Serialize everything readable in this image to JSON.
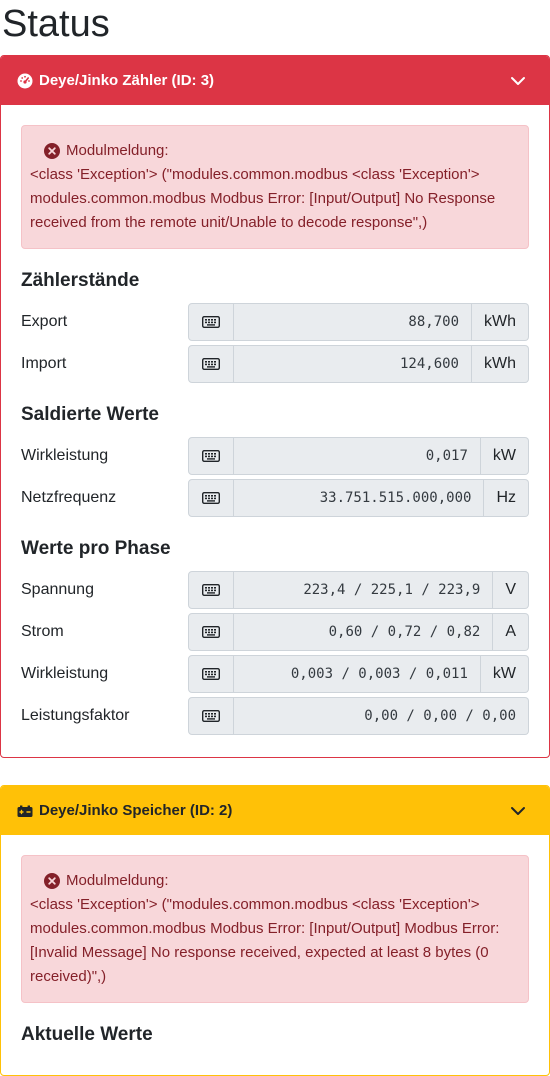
{
  "page": {
    "title": "Status"
  },
  "counter_card": {
    "title": "Deye/Jinko Zähler (ID: 3)",
    "alert": {
      "title": "Modulmeldung:",
      "text": "<class 'Exception'> (\"modules.common.modbus <class 'Exception'> modules.common.modbus Modbus Error: [Input/Output] No Response received from the remote unit/Unable to decode response\",)"
    },
    "sections": [
      {
        "title": "Zählerstände",
        "rows": [
          {
            "label": "Export",
            "value": "88,700",
            "unit": "kWh"
          },
          {
            "label": "Import",
            "value": "124,600",
            "unit": "kWh"
          }
        ]
      },
      {
        "title": "Saldierte Werte",
        "rows": [
          {
            "label": "Wirkleistung",
            "value": "0,017",
            "unit": "kW"
          },
          {
            "label": "Netzfrequenz",
            "value": "33.751.515.000,000",
            "unit": "Hz"
          }
        ]
      },
      {
        "title": "Werte pro Phase",
        "rows": [
          {
            "label": "Spannung",
            "value": "223,4 / 225,1 / 223,9",
            "unit": "V"
          },
          {
            "label": "Strom",
            "value": "0,60 / 0,72 / 0,82",
            "unit": "A"
          },
          {
            "label": "Wirkleistung",
            "value": "0,003 / 0,003 / 0,011",
            "unit": "kW"
          },
          {
            "label": "Leistungsfaktor",
            "value": "0,00 / 0,00 / 0,00",
            "unit": ""
          }
        ]
      }
    ]
  },
  "storage_card": {
    "title": "Deye/Jinko Speicher (ID: 2)",
    "alert": {
      "title": "Modulmeldung:",
      "text": "<class 'Exception'> (\"modules.common.modbus <class 'Exception'> modules.common.modbus Modbus Error: [Input/Output] Modbus Error: [Invalid Message] No response received, expected at least 8 bytes (0 received)\",)"
    },
    "section_title": "Aktuelle Werte"
  },
  "icons": {
    "counter_header": "gauge-icon",
    "storage_header": "battery-icon",
    "collapse": "chevron-down-icon",
    "error": "x-circle-icon",
    "field": "keyboard-icon"
  },
  "colors": {
    "danger": "#dc3545",
    "warning": "#ffc107",
    "alert_bg": "#f8d7da",
    "alert_text": "#842029",
    "input_bg": "#e9ecef"
  }
}
